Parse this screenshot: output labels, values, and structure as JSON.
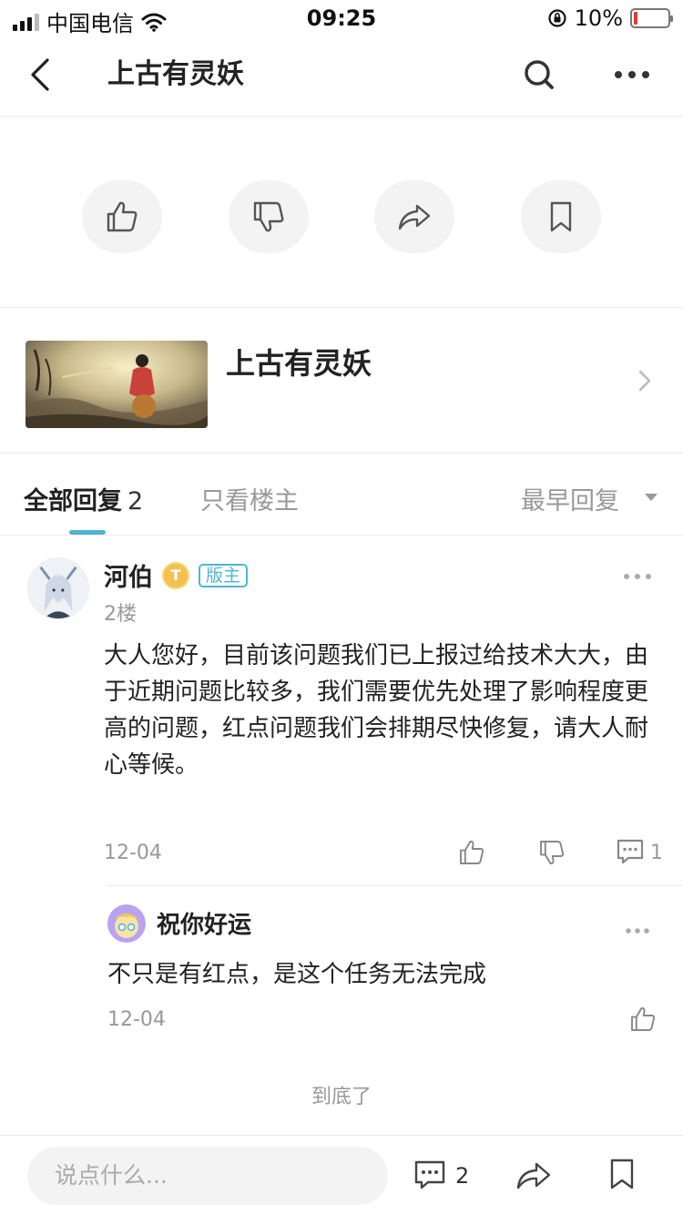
{
  "status_bar": {
    "carrier": "中国电信",
    "time": "09:25",
    "battery": "10%",
    "battery_level": 0.1
  },
  "nav": {
    "title": "上古有灵妖",
    "icons": [
      "back-arrow-icon",
      "search-icon",
      "more-dots-icon"
    ]
  },
  "actions": {
    "icons": [
      "thumb-up-icon",
      "thumb-down-icon",
      "share-icon",
      "bookmark-icon"
    ]
  },
  "topic": {
    "name": "上古有灵妖"
  },
  "tabs": {
    "all_label": "全部回复",
    "all_count": "2",
    "op_only": "只看楼主",
    "sort": "最早回复"
  },
  "comment": {
    "user": "河伯",
    "level_badge": "T",
    "role_badge": "版主",
    "floor": "2楼",
    "body": "大人您好，目前该问题我们已上报过给技术大大，由于近期问题比较多，我们需要优先处理了影响程度更高的问题，红点问题我们会排期尽快修复，请大人耐心等候。",
    "date": "12-04",
    "reply_count": "1",
    "reply": {
      "user": "祝你好运",
      "body": "不只是有红点，是这个任务无法完成",
      "date": "12-04"
    }
  },
  "end_text": "到底了",
  "bottom_bar": {
    "input_placeholder": "说点什么...",
    "comment_count": "2"
  },
  "colors": {
    "accent": "#4db6d0",
    "muted": "#999999",
    "circle_bg": "#f3f3f3",
    "battery_low": "#e53935"
  }
}
